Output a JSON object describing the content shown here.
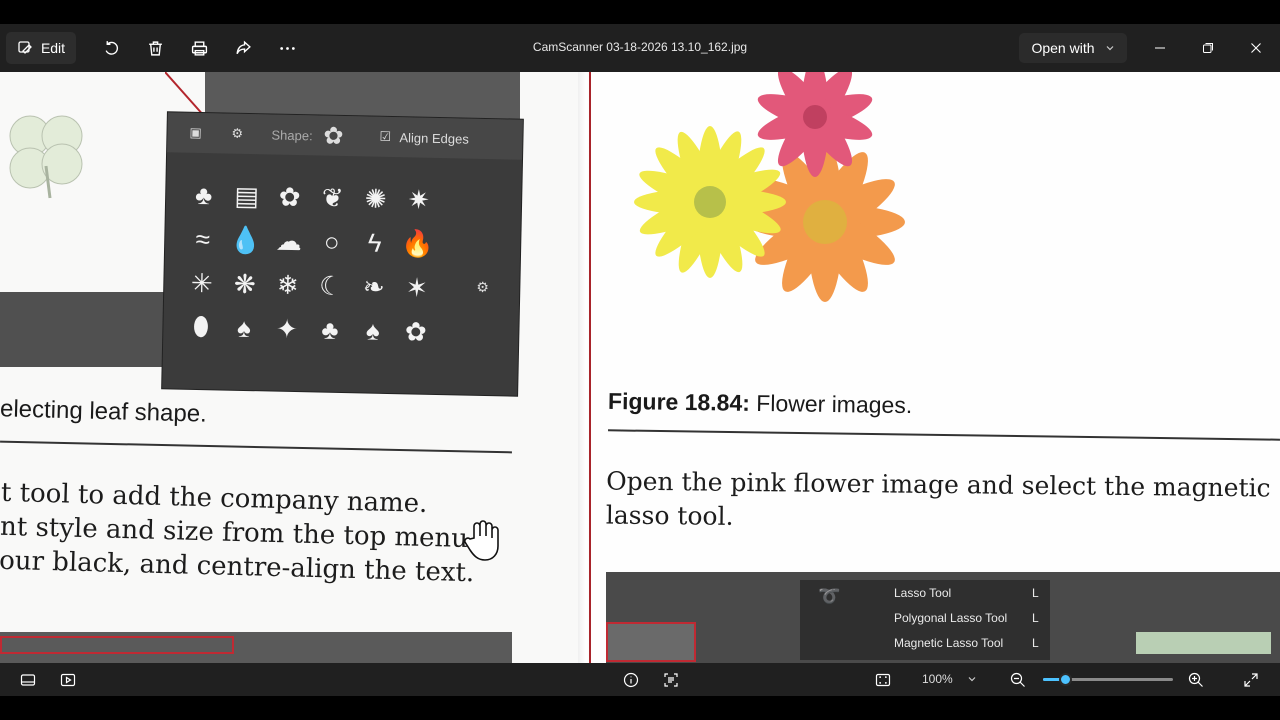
{
  "toolbar": {
    "edit_label": "Edit",
    "filename": "CamScanner 03-18-2026 13.10_162.jpg",
    "open_with_label": "Open with"
  },
  "photo": {
    "left_caption": "electing leaf shape.",
    "left_body": [
      "t tool to add the company name.",
      "nt style and size from the top menu.",
      "our black, and centre-align the text."
    ],
    "ps_panel": {
      "shape_label": "Shape:",
      "align_label": "Align Edges",
      "shapes": [
        "♣",
        "▤",
        "✿",
        "❦",
        "✺",
        "✷",
        "≈",
        "💧",
        "☁",
        "○",
        "ϟ",
        "🔥",
        "✳",
        "❋",
        "❄",
        "☾",
        "❧",
        "✶",
        "⬮",
        "♠",
        "✦",
        "♣",
        "♠",
        "✿"
      ]
    },
    "right_caption_bold": "Figure 18.84:",
    "right_caption_rest": " Flower images.",
    "right_body": [
      "Open the pink flower image and select the magnetic",
      "lasso tool."
    ],
    "lasso_menu": [
      "Lasso Tool",
      "Polygonal Lasso Tool",
      "Magnetic Lasso Tool"
    ],
    "lasso_shortcut": "L"
  },
  "status": {
    "zoom_value": "100%",
    "zoom_fraction": 0.17
  },
  "colors": {
    "accent": "#4cc2ff",
    "bar_bg": "#202020",
    "page_red": "#a8232a"
  }
}
